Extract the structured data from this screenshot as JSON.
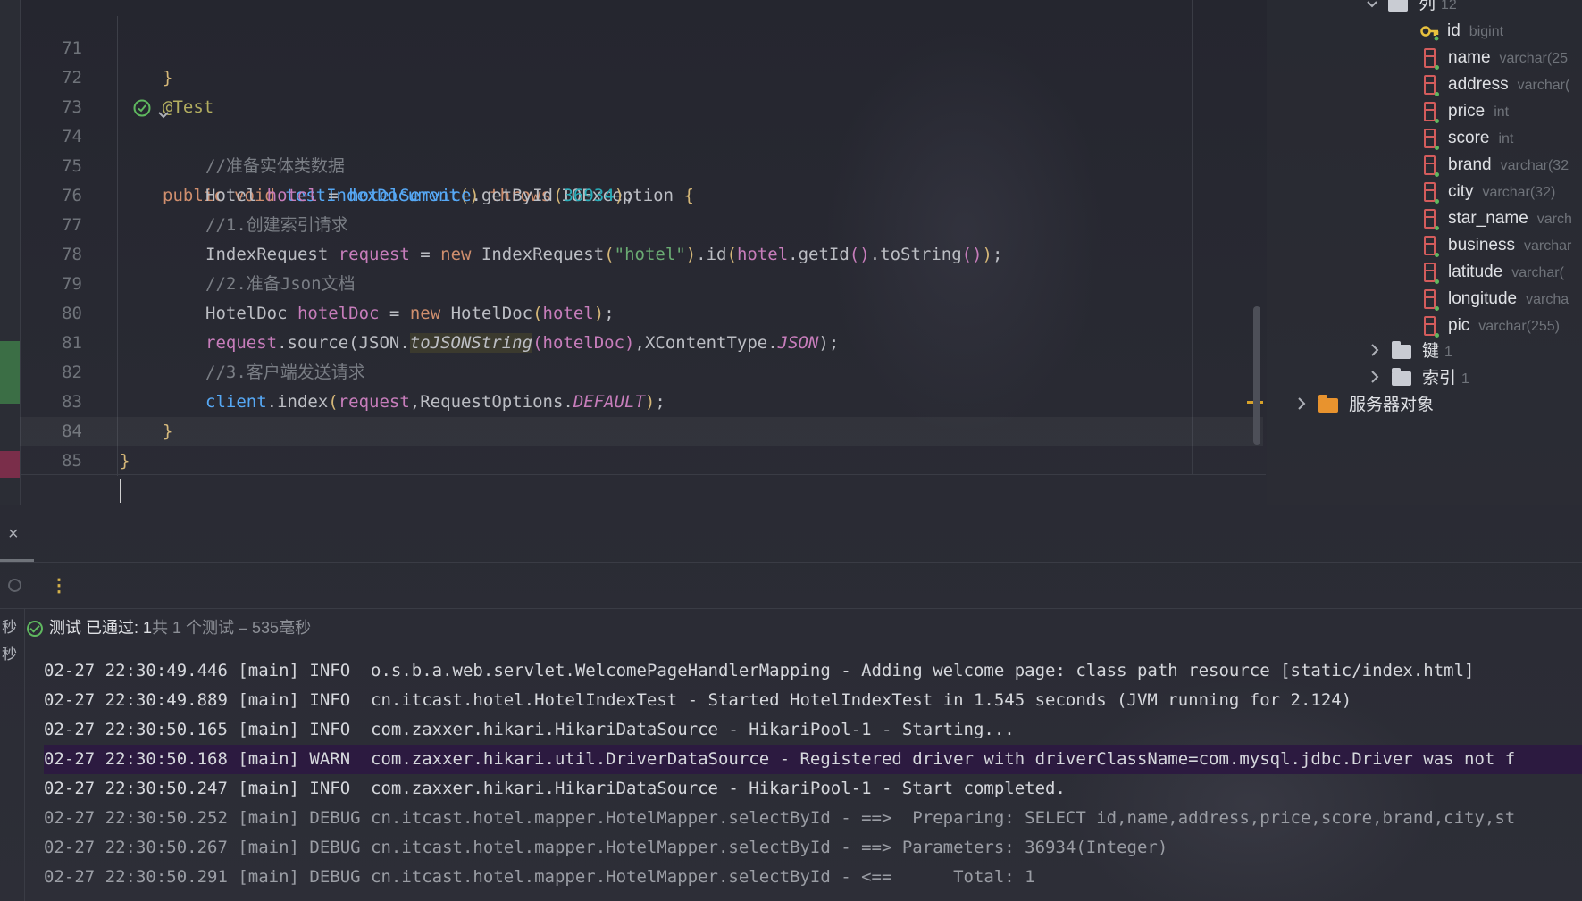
{
  "editor": {
    "lines": [
      {
        "num": "71"
      },
      {
        "num": "72"
      },
      {
        "num": "73"
      },
      {
        "num": "74"
      },
      {
        "num": "75"
      },
      {
        "num": "76"
      },
      {
        "num": "77"
      },
      {
        "num": "78"
      },
      {
        "num": "79"
      },
      {
        "num": "80"
      },
      {
        "num": "81"
      },
      {
        "num": "82"
      },
      {
        "num": "83"
      },
      {
        "num": "84"
      },
      {
        "num": "85"
      }
    ],
    "tokens": {
      "l71_brace": "}",
      "l72_ann": "@Test",
      "l73_public": "public",
      "l73_void": "void",
      "l73_name": "testIndexDocument",
      "l73_parens": "()",
      "l73_throws": "throws",
      "l73_exc": "IOException",
      "l73_brace": "{",
      "l74_comment": "//准备实体类数据",
      "l75_type": "Hotel",
      "l75_var": "hotel",
      "l75_eq": " = ",
      "l75_svc": "hotelService",
      "l75_call": ".getById",
      "l75_p1": "(",
      "l75_num": "36934",
      "l75_p2": ")",
      "l75_semi": ";",
      "l76_comment": "//1.创建索引请求",
      "l77_type": "IndexRequest",
      "l77_var": "request",
      "l77_eq": " = ",
      "l77_new": "new",
      "l77_ctor": " IndexRequest",
      "l77_p1": "(",
      "l77_str": "\"hotel\"",
      "l77_p2": ")",
      "l77_id": ".id",
      "l77_p3": "(",
      "l77_hotel": "hotel",
      "l77_getid": ".getId",
      "l77_p4": "()",
      "l77_tostr": ".toString",
      "l77_p5": "()",
      "l77_p6": ")",
      "l77_semi": ";",
      "l78_comment": "//2.准备Json文档",
      "l79_type": "HotelDoc",
      "l79_var": "hotelDoc",
      "l79_eq": " = ",
      "l79_new": "new",
      "l79_ctor": " HotelDoc",
      "l79_p1": "(",
      "l79_arg": "hotel",
      "l79_p2": ")",
      "l79_semi": ";",
      "l80_req": "request",
      "l80_src": ".source(JSON.",
      "l80_fn": "toJSONString",
      "l80_p1": "(",
      "l80_arg": "hotelDoc",
      "l80_p2": ")",
      "l80_rest": ",XContentType.",
      "l80_json": "JSON",
      "l80_end": ");",
      "l81_comment": "//3.客户端发送请求",
      "l82_client": "client",
      "l82_idx": ".index",
      "l82_p1": "(",
      "l82_req": "request",
      "l82_rest": ",RequestOptions.",
      "l82_def": "DEFAULT",
      "l82_p2": ")",
      "l82_semi": ";",
      "l83_brace": "}",
      "l84_brace": "}"
    }
  },
  "db_tree": {
    "columns_folder": {
      "label": "列",
      "count": "12"
    },
    "columns": [
      {
        "name": "id",
        "type": "bigint",
        "key": true
      },
      {
        "name": "name",
        "type": "varchar(25"
      },
      {
        "name": "address",
        "type": "varchar("
      },
      {
        "name": "price",
        "type": "int"
      },
      {
        "name": "score",
        "type": "int"
      },
      {
        "name": "brand",
        "type": "varchar(32"
      },
      {
        "name": "city",
        "type": "varchar(32)"
      },
      {
        "name": "star_name",
        "type": "varch"
      },
      {
        "name": "business",
        "type": "varchar"
      },
      {
        "name": "latitude",
        "type": "varchar("
      },
      {
        "name": "longitude",
        "type": "varcha"
      },
      {
        "name": "pic",
        "type": "varchar(255)"
      }
    ],
    "keys_folder": {
      "label": "键",
      "count": "1"
    },
    "index_folder": {
      "label": "索引",
      "count": "1"
    },
    "server_objects": {
      "label": "服务器对象"
    }
  },
  "run_panel": {
    "side_labels": [
      "秒",
      "秒"
    ],
    "close_icon": "×",
    "more_icon": "⋮",
    "status": {
      "passed_label": "测试 已通过: 1",
      "meta": "共 1 个测试 – 535毫秒"
    },
    "log": [
      {
        "level": "info",
        "text": "02-27 22:30:49.446 [main] INFO  o.s.b.a.web.servlet.WelcomePageHandlerMapping - Adding welcome page: class path resource [static/index.html]"
      },
      {
        "level": "info",
        "text": "02-27 22:30:49.889 [main] INFO  cn.itcast.hotel.HotelIndexTest - Started HotelIndexTest in 1.545 seconds (JVM running for 2.124)"
      },
      {
        "level": "info",
        "text": "02-27 22:30:50.165 [main] INFO  com.zaxxer.hikari.HikariDataSource - HikariPool-1 - Starting..."
      },
      {
        "level": "warn",
        "text": "02-27 22:30:50.168 [main] WARN  com.zaxxer.hikari.util.DriverDataSource - Registered driver with driverClassName=com.mysql.jdbc.Driver was not f"
      },
      {
        "level": "info",
        "text": "02-27 22:30:50.247 [main] INFO  com.zaxxer.hikari.HikariDataSource - HikariPool-1 - Start completed."
      },
      {
        "level": "debug",
        "text": "02-27 22:30:50.252 [main] DEBUG cn.itcast.hotel.mapper.HotelMapper.selectById - ==>  Preparing: SELECT id,name,address,price,score,brand,city,st"
      },
      {
        "level": "debug",
        "text": "02-27 22:30:50.267 [main] DEBUG cn.itcast.hotel.mapper.HotelMapper.selectById - ==> Parameters: 36934(Integer)"
      },
      {
        "level": "debug",
        "text": "02-27 22:30:50.291 [main] DEBUG cn.itcast.hotel.mapper.HotelMapper.selectById - <==      Total: 1"
      }
    ]
  },
  "colors": {
    "keyword": "#cf8e6d",
    "annotation": "#b3ae60",
    "function": "#56a8f5",
    "comment": "#7a7e85",
    "string": "#6aab73",
    "number": "#2aacb8",
    "local_var": "#c77dbb",
    "pass_green": "#5fb85f",
    "warn_bg": "#2c1a40"
  }
}
